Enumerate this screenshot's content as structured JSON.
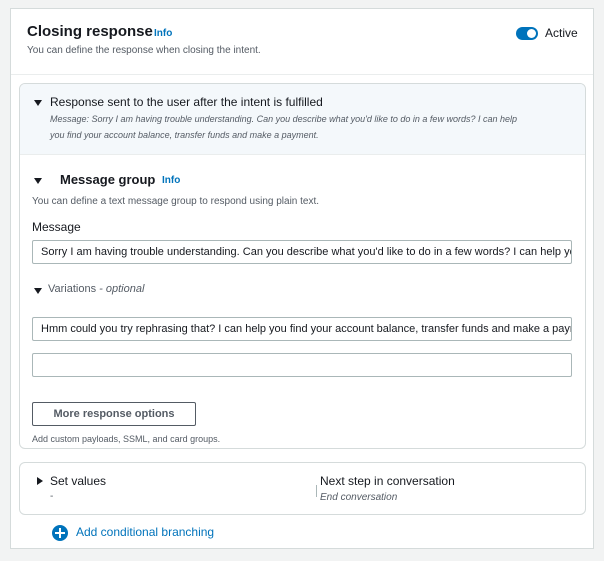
{
  "closing_response": {
    "title": "Closing response",
    "info": "Info",
    "description": "You can define the response when closing the intent.",
    "active_label": "Active",
    "active": true
  },
  "fulfilled_section": {
    "title": "Response sent to the user after the intent is fulfilled",
    "message_line1": "Message: Sorry I am having trouble understanding. Can you describe what you'd like to do in a few words? I can help",
    "message_line2": "you find your account balance, transfer funds and make a payment."
  },
  "message_group": {
    "title": "Message group",
    "info": "Info",
    "description": "You can define a text message group to respond using plain text.",
    "message_label": "Message",
    "message_value": "Sorry I am having trouble understanding. Can you describe what you'd like to do in a few words? I can help you find your account balance, transfer funds and make a payment.",
    "variations_label": "Variations",
    "variations_optional": "- optional",
    "variation_1": "Hmm could you try rephrasing that? I can help you find your account balance, transfer funds and make a payment.",
    "variation_2": "",
    "more_button": "More response options",
    "more_hint": "Add custom payloads, SSML, and card groups."
  },
  "set_values": {
    "label": "Set values",
    "value": "-",
    "next_step_label": "Next step in conversation",
    "next_step_value": "End conversation"
  },
  "add_branching": "Add conditional branching"
}
